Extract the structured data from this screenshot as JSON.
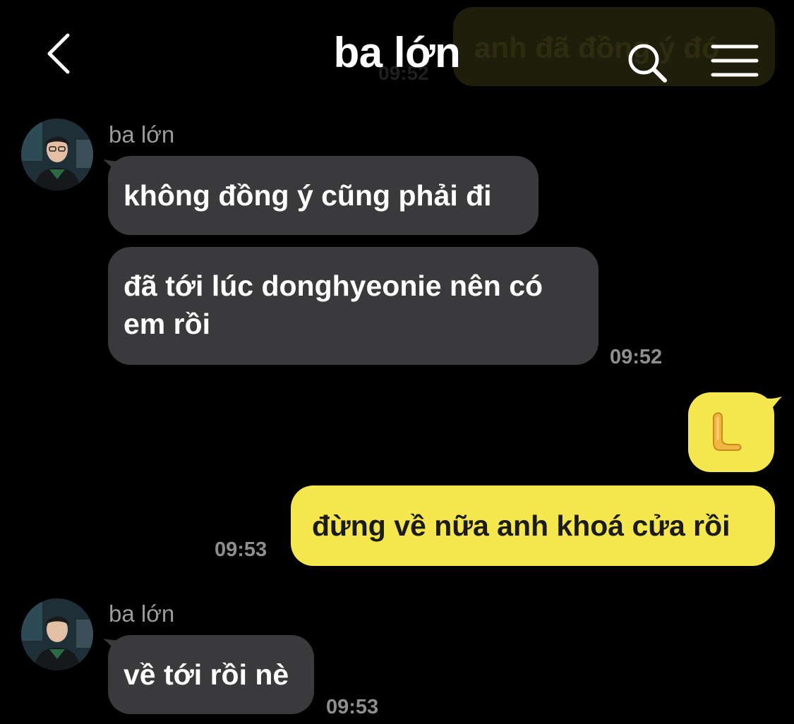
{
  "header": {
    "title": "ba lớn",
    "ghost_message": "anh đã đồng ý đó",
    "ghost_time": "09:52",
    "back_icon": "chevron-left-icon",
    "search_icon": "search-icon",
    "menu_icon": "hamburger-menu-icon"
  },
  "colors": {
    "background": "#000000",
    "incoming_bubble": "#3a3a3c",
    "outgoing_bubble": "#f6e74e",
    "timestamp": "#8e8e8e",
    "sender_name": "#9c9c9c"
  },
  "messages": [
    {
      "sender": "ba lớn",
      "direction": "in",
      "bubbles": [
        "không đồng ý cũng phải đi",
        "đã tới lúc donghyeonie nên có em rồi"
      ],
      "time": "09:52"
    },
    {
      "direction": "out",
      "bubbles": [
        "🫷",
        "đừng về nữa anh khoá cửa rồi"
      ],
      "time": "09:53"
    },
    {
      "sender": "ba lớn",
      "direction": "in",
      "bubbles": [
        "về tới rồi nè"
      ],
      "time": "09:53"
    }
  ]
}
